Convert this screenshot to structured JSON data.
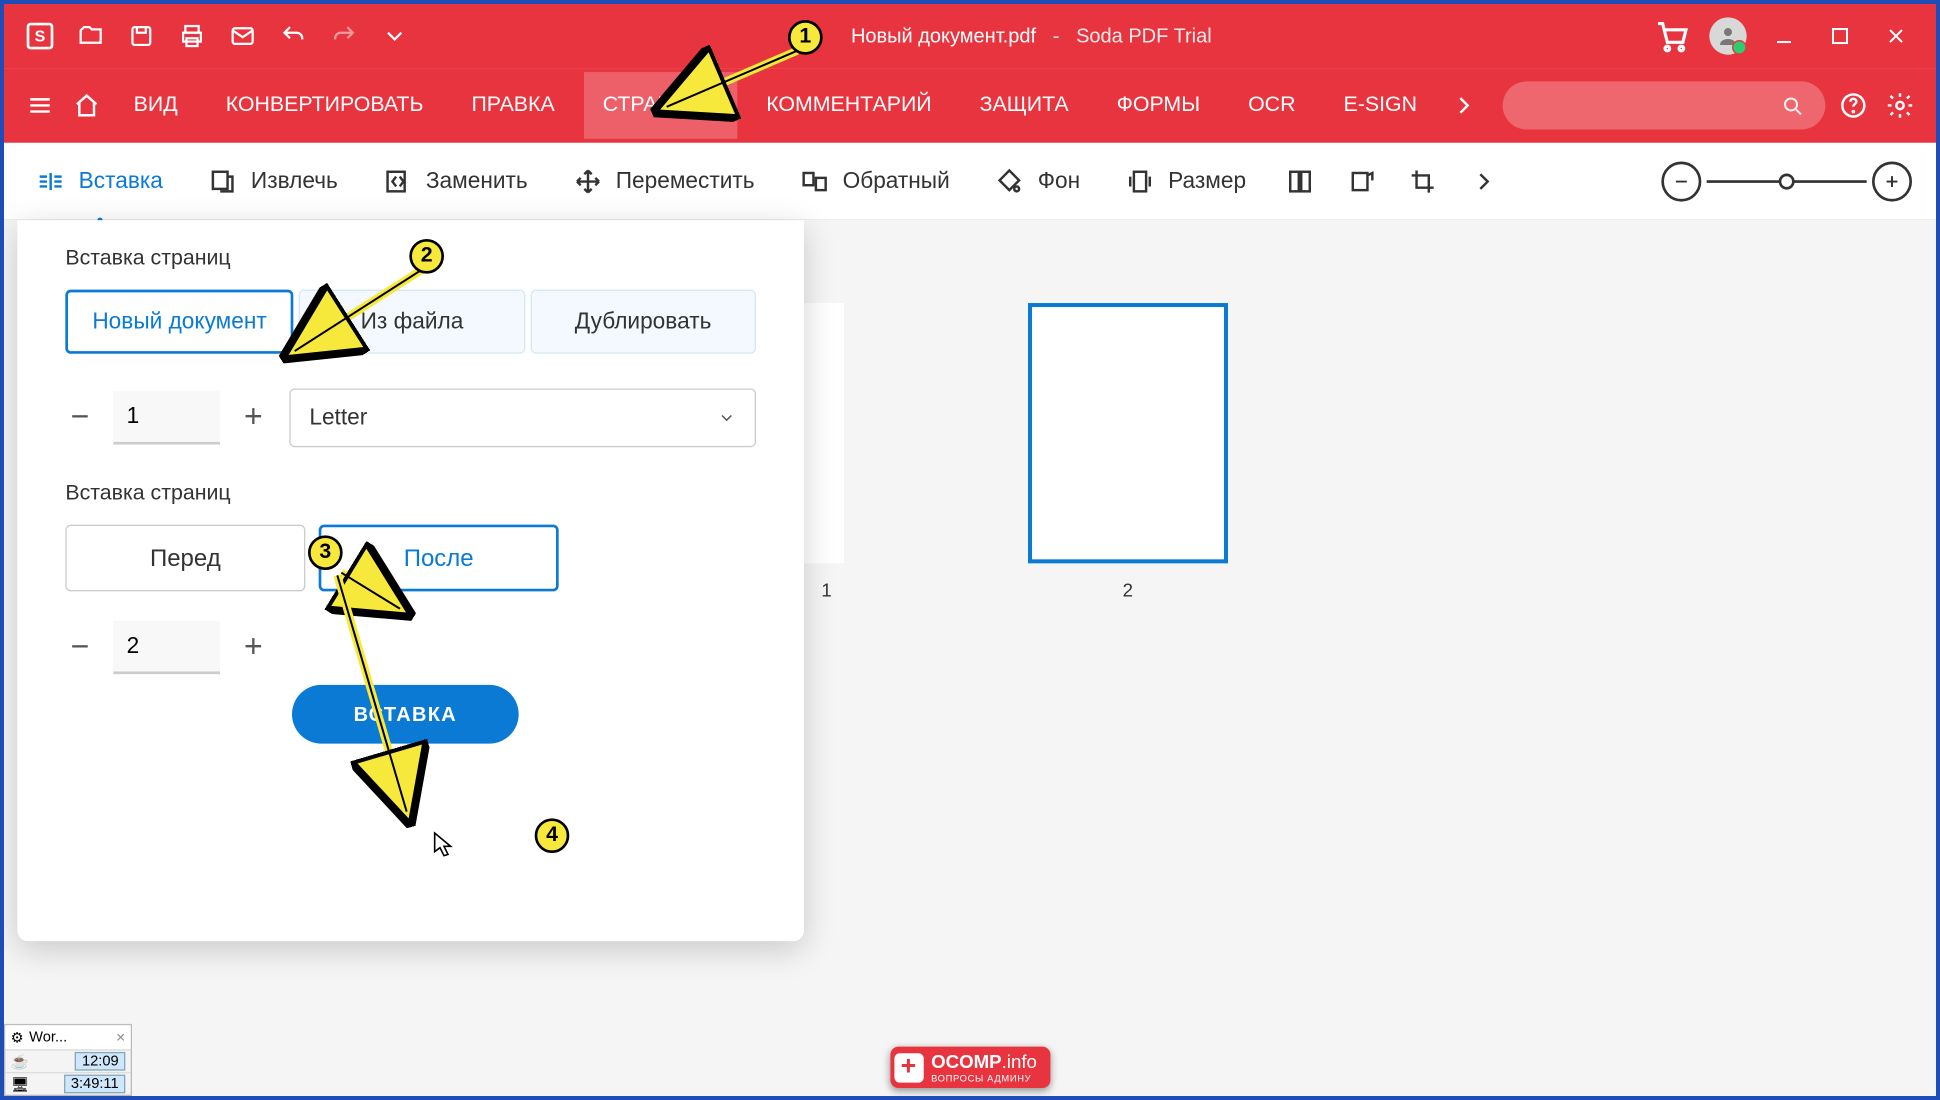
{
  "app": {
    "doc_title": "Новый документ.pdf",
    "sep": "-",
    "product": "Soda PDF Trial"
  },
  "tabs": {
    "vid": "ВИД",
    "convert": "КОНВЕРТИРОВАТЬ",
    "edit": "ПРАВКА",
    "page": "СТРАНИЦА",
    "comment": "КОММЕНТАРИЙ",
    "protect": "ЗАЩИТА",
    "forms": "ФОРМЫ",
    "ocr": "OCR",
    "esign": "E-SIGN"
  },
  "toolbar": {
    "insert": "Вставка",
    "extract": "Извлечь",
    "replace": "Заменить",
    "move": "Переместить",
    "reverse": "Обратный",
    "background": "Фон",
    "size": "Размер"
  },
  "panel": {
    "title1": "Вставка страниц",
    "tab_newdoc": "Новый документ",
    "tab_fromfile": "Из файла",
    "tab_duplicate": "Дублировать",
    "count": "1",
    "paper": "Letter",
    "title2": "Вставка страниц",
    "before": "Перед",
    "after": "После",
    "position": "2",
    "submit": "ВСТАВКА"
  },
  "pages": {
    "p1": "1",
    "p2": "2"
  },
  "callouts": {
    "c1": "1",
    "c2": "2",
    "c3": "3",
    "c4": "4"
  },
  "watermark": {
    "brand": "OCOMP",
    "tld": ".info",
    "sub": "ВОПРОСЫ АДМИНУ"
  },
  "taskbar": {
    "tab": "Wor...",
    "t1": "12:09",
    "t2": "3:49:11"
  }
}
